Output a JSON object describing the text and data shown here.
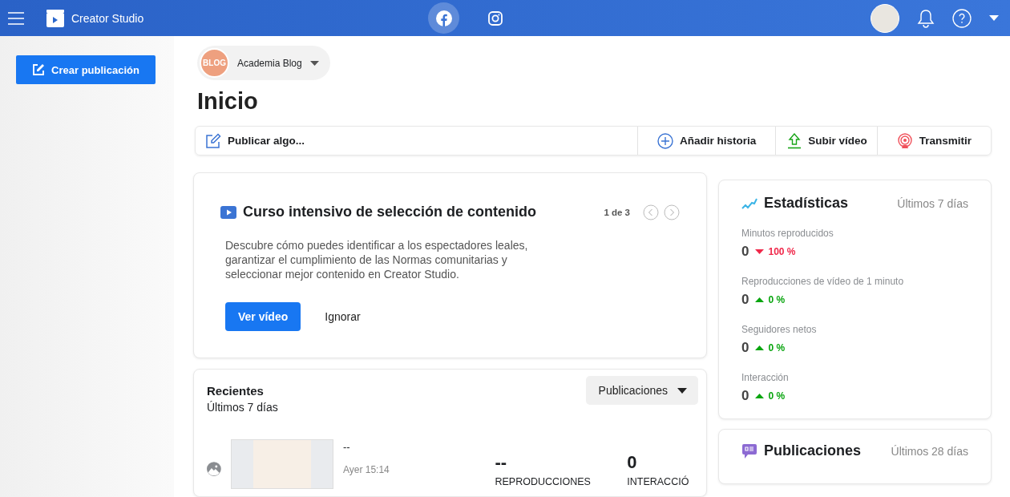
{
  "topbar": {
    "title": "Creator Studio",
    "platforms": [
      {
        "kind": "facebook",
        "selected": true
      },
      {
        "kind": "instagram",
        "selected": false
      }
    ]
  },
  "sidebar": {
    "create_button": "Crear publicación"
  },
  "page_selector": {
    "avatar_text": "BLOG",
    "name": "Academia Blog"
  },
  "heading": "Inicio",
  "actions": [
    {
      "kind": "compose",
      "label": "Publicar algo..."
    },
    {
      "kind": "story",
      "label": "Añadir historia"
    },
    {
      "kind": "upload",
      "label": "Subir vídeo"
    },
    {
      "kind": "live",
      "label": "Transmitir"
    }
  ],
  "promo": {
    "title": "Curso intensivo de selección de contenido",
    "pager": "1 de 3",
    "text": "Descubre cómo puedes identificar a los espectadores leales, garantizar el cumplimiento de las Normas comunitarias y seleccionar mejor contenido en Creator Studio.",
    "primary": "Ver vídeo",
    "secondary": "Ignorar"
  },
  "recent": {
    "title": "Recientes",
    "subtitle": "Últimos 7 días",
    "filter": "Publicaciones",
    "rows": [
      {
        "title": "--",
        "time": "Ayer 15:14",
        "metrics": [
          {
            "value": "--",
            "label": "REPRODUCCIONES"
          },
          {
            "value": "0",
            "label": "INTERACCIÓ"
          }
        ]
      }
    ]
  },
  "stats": {
    "title": "Estadísticas",
    "period": "Últimos 7 días",
    "items": [
      {
        "label": "Minutos reproducidos",
        "value": "0",
        "change": "100 %",
        "kind": "down"
      },
      {
        "label": "Reproducciones de vídeo de 1 minuto",
        "value": "0",
        "change": "0 %",
        "kind": "up"
      },
      {
        "label": "Seguidores netos",
        "value": "0",
        "change": "0 %",
        "kind": "up"
      },
      {
        "label": "Interacción",
        "value": "0",
        "change": "0 %",
        "kind": "up"
      }
    ]
  },
  "posts": {
    "title": "Publicaciones",
    "period": "Últimos 28 días"
  }
}
